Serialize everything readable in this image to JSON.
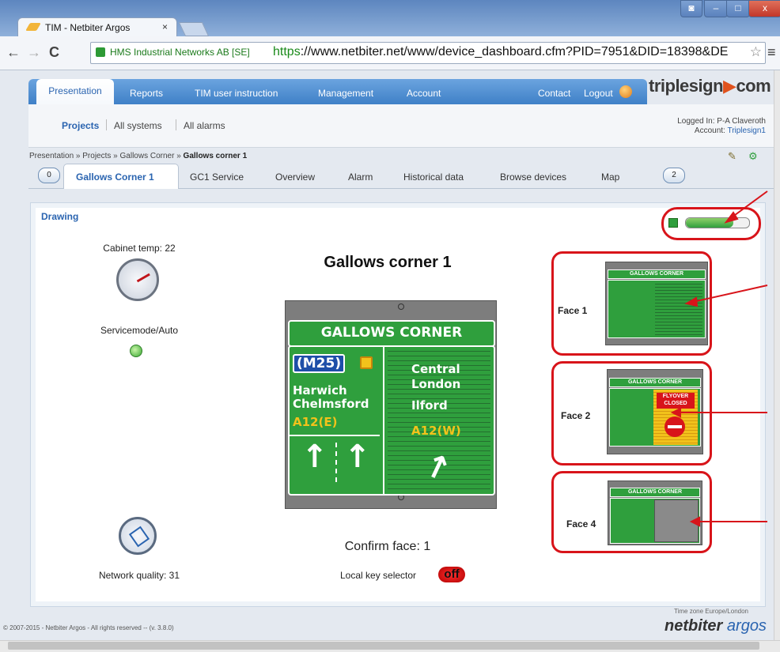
{
  "browser": {
    "tab_title": "TIM - Netbiter Argos",
    "tab_close": "×",
    "site_identity": "HMS Industrial Networks AB [SE]",
    "url_scheme": "https",
    "url_rest": "://www.netbiter.net/www/device_dashboard.cfm?PID=7951&DID=18398&DE",
    "back": "←",
    "forward": "→",
    "reload": "C",
    "menu": "≡",
    "star": "☆",
    "win_min": "–",
    "win_max": "□",
    "win_close": "x"
  },
  "topnav": {
    "items": [
      "Presentation",
      "Reports",
      "TIM user instruction",
      "Management",
      "Account"
    ],
    "contact": "Contact",
    "logout": "Logout",
    "logo_left": "triplesign",
    "logo_right": "com"
  },
  "subnav": {
    "items": [
      "Projects",
      "All systems",
      "All alarms"
    ],
    "logged_in": "Logged In: P-A Claveroth",
    "account_label": "Account:",
    "account_value": "Triplesign1"
  },
  "breadcrumb": {
    "path": "Presentation » Projects » Gallows Corner » ",
    "current": "Gallows corner 1"
  },
  "tabs": {
    "prev_page": "0",
    "next_page": "2",
    "items": [
      "Gallows Corner 1",
      "GC1 Service",
      "Overview",
      "Alarm",
      "Historical data",
      "Browse devices",
      "Map"
    ]
  },
  "drawing": {
    "section_label": "Drawing",
    "title": "Gallows corner 1",
    "cabinet_temp": "Cabinet temp: 22",
    "servicemode": "Servicemode/Auto",
    "network_quality": "Network quality: 31",
    "confirm_face": "Confirm face: 1",
    "local_key_label": "Local key selector",
    "local_key_state": "off",
    "toggle_level": 0.75
  },
  "sign": {
    "header": "GALLOWS CORNER",
    "m25": "(M25)",
    "left_lines": [
      "Harwich",
      "Chelmsford"
    ],
    "left_road": "A12(E)",
    "right_lines": [
      "Central",
      "London",
      "Ilford"
    ],
    "right_road": "A12(W)",
    "flyover": "FLYOVER",
    "closed": "CLOSED"
  },
  "faces": [
    "Face 1",
    "Face 2",
    "Face 4"
  ],
  "footer": {
    "copyright": "© 2007-2015 - Netbiter Argos - All rights reserved -- (v. 3.8.0)",
    "timezone": "Time zone Europe/London",
    "brand_left": "netbiter",
    "brand_right": "argos"
  },
  "colors": {
    "sign_green": "#2f9f3d",
    "sign_yellow": "#f2c21b",
    "callout_red": "#d8141a",
    "nav_blue": "#3f80c7"
  }
}
